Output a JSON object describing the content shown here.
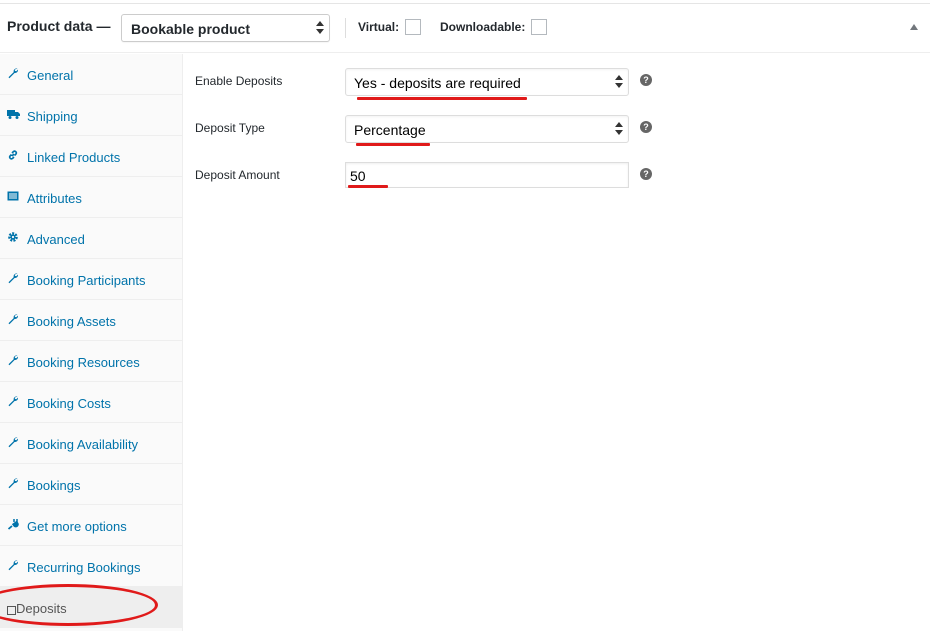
{
  "header": {
    "title": "Product data —",
    "product_type": "Bookable product",
    "virtual_label": "Virtual:",
    "downloadable_label": "Downloadable:"
  },
  "sidebar": {
    "items": [
      {
        "label": "General",
        "icon": "wrench-icon"
      },
      {
        "label": "Shipping",
        "icon": "truck-icon"
      },
      {
        "label": "Linked Products",
        "icon": "link-icon"
      },
      {
        "label": "Attributes",
        "icon": "list-icon"
      },
      {
        "label": "Advanced",
        "icon": "gear-icon"
      },
      {
        "label": "Booking Participants",
        "icon": "wrench-icon"
      },
      {
        "label": "Booking Assets",
        "icon": "wrench-icon"
      },
      {
        "label": "Booking Resources",
        "icon": "wrench-icon"
      },
      {
        "label": "Booking Costs",
        "icon": "wrench-icon"
      },
      {
        "label": "Booking Availability",
        "icon": "wrench-icon"
      },
      {
        "label": "Bookings",
        "icon": "wrench-icon"
      },
      {
        "label": "Get more options",
        "icon": "plug-icon"
      },
      {
        "label": "Recurring Bookings",
        "icon": "wrench-icon"
      },
      {
        "label": "Deposits",
        "icon": "box-icon"
      }
    ]
  },
  "fields": {
    "enable_deposits": {
      "label": "Enable Deposits",
      "value": "Yes - deposits are required"
    },
    "deposit_type": {
      "label": "Deposit Type",
      "value": "Percentage"
    },
    "deposit_amount": {
      "label": "Deposit Amount",
      "value": "50"
    },
    "help_glyph": "?"
  },
  "colors": {
    "link_blue": "#0073aa",
    "annotation_red": "#e01a1a"
  }
}
